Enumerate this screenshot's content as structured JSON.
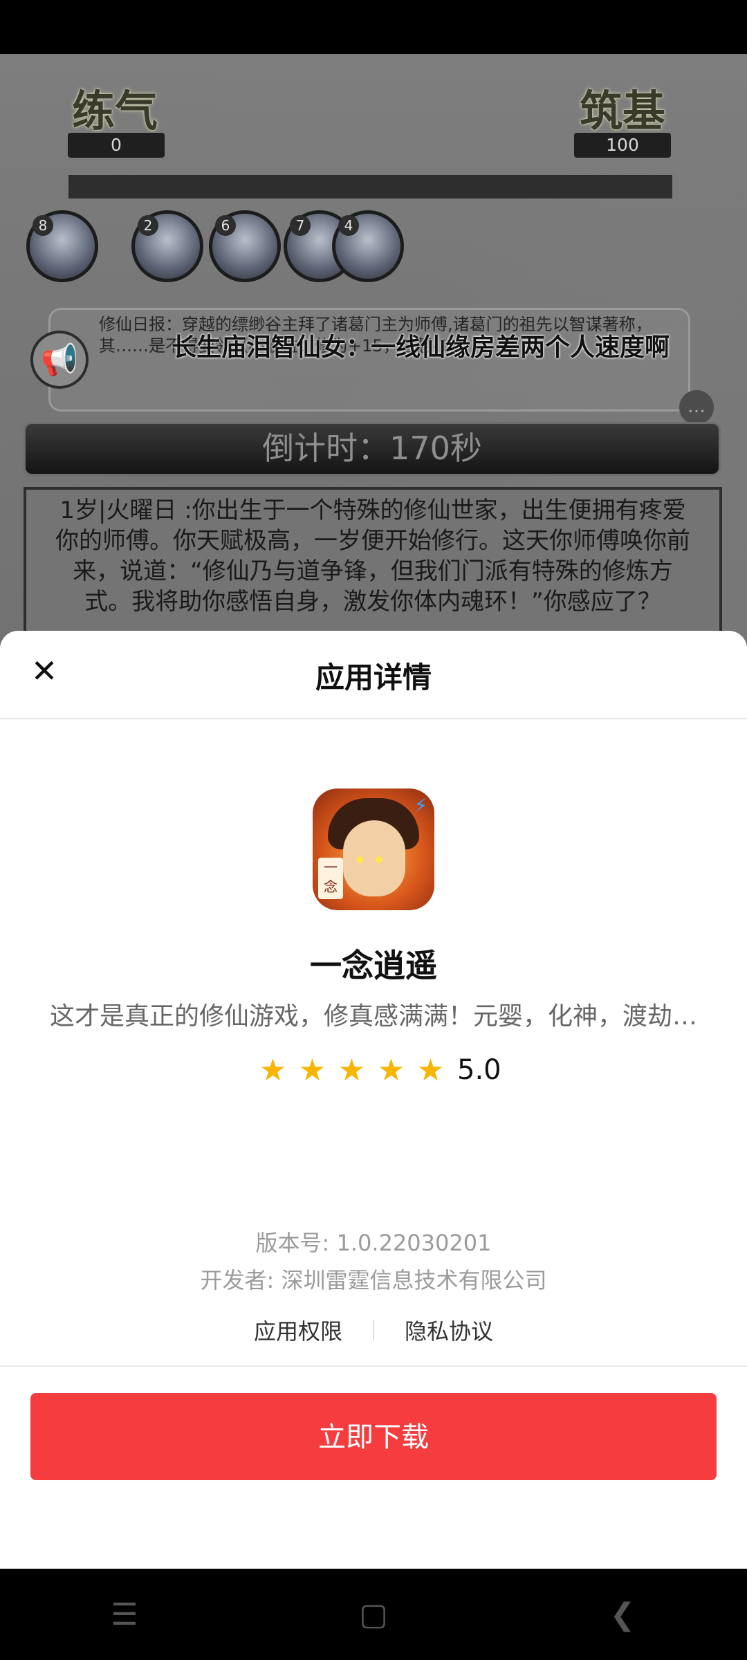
{
  "game": {
    "realm_left": {
      "name": "练气",
      "value": "0"
    },
    "realm_right": {
      "name": "筑基",
      "value": "100"
    },
    "party": [
      {
        "level": "8"
      },
      {
        "level": "2"
      },
      {
        "level": "6"
      },
      {
        "level": "7"
      },
      {
        "level": "4"
      }
    ],
    "news": "修仙日报：穿越的缥缈谷主拜了诸葛门主为师傅,诸葛门的祖先以智谋著称，其……是不得要领（小收益：修为+15，智慧-1）",
    "danmaku": "长生庙泪智仙女：一线仙缘房差两个人速度啊",
    "countdown": "倒计时：170秒",
    "story": "1岁|火曜日 :你出生于一个特殊的修仙世家，出生便拥有疼爱你的师傅。你天赋极高，一岁便开始修行。这天你师傅唤你前来，说道：“修仙乃与道争锋，但我们门派有特殊的修炼方式。我将助你感悟自身，激发你体内魂环！”你感应了？"
  },
  "sheet": {
    "title": "应用详情",
    "close_icon": "close-icon",
    "app": {
      "name": "一念逍遥",
      "description": "这才是真正的修仙游戏，修真感满满！元婴，化神，渡劫…",
      "rating": "5.0",
      "stars": 5,
      "version": "版本号: 1.0.22030201",
      "developer": "开发者: 深圳雷霆信息技术有限公司"
    },
    "links": {
      "permissions": "应用权限",
      "privacy": "隐私协议"
    },
    "download_label": "立即下载"
  },
  "colors": {
    "accent": "#f53d3f",
    "star": "#f7b500"
  }
}
